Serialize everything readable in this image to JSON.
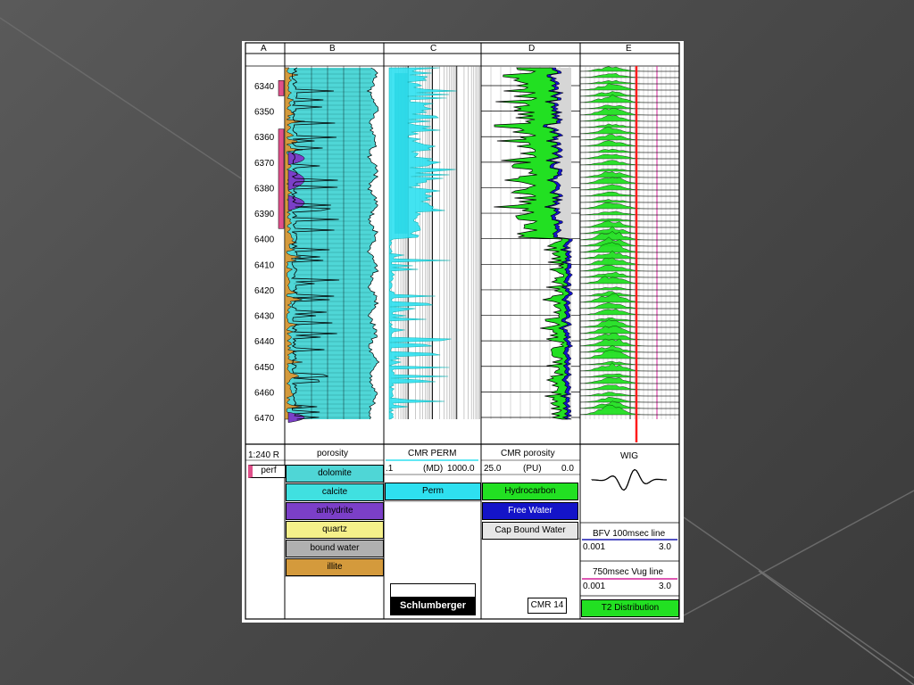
{
  "tracks": [
    "A",
    "B",
    "C",
    "D",
    "E"
  ],
  "depth_ticks": [
    6340,
    6350,
    6360,
    6370,
    6380,
    6390,
    6400,
    6410,
    6420,
    6430,
    6440,
    6450,
    6460,
    6470
  ],
  "colors": {
    "dolomite": "#4fd6d6",
    "calcite": "#40e0e0",
    "anhydrite": "#7b3fc8",
    "quartz": "#f5f08a",
    "bound_water": "#b0b0b0",
    "illite": "#d49a3c",
    "perm": "#2ee0f0",
    "hydrocarbon": "#22e022",
    "free_water": "#1414c8",
    "perf": "#e0508a",
    "wig_line": "#ff1a1a",
    "bfv_line": "#1a1ab0",
    "vug_line": "#d4209a"
  },
  "legend": {
    "scale": "1:240 R",
    "perf": "perf",
    "porosity_title": "porosity",
    "lithology": [
      "dolomite",
      "calcite",
      "anhydrite",
      "quartz",
      "bound water",
      "illite"
    ],
    "cmr_perm_title": "CMR PERM",
    "perm_left": ".1",
    "perm_unit": "(MD)",
    "perm_right": "1000.0",
    "perm_label": "Perm",
    "logo": "Schlumberger",
    "cmr_por_title": "CMR porosity",
    "por_left": "25.0",
    "por_unit": "(PU)",
    "por_right": "0.0",
    "fluids": [
      "Hydrocarbon",
      "Free Water",
      "Cap Bound Water"
    ],
    "tool": "CMR 14",
    "wig_title": "WIG",
    "bfv_title": "BFV 100msec line",
    "bfv_left": "0.001",
    "bfv_right": "3.0",
    "vug_title": "750msec Vug line",
    "vug_left": "0.001",
    "vug_right": "3.0",
    "t2_label": "T2 Distribution"
  }
}
